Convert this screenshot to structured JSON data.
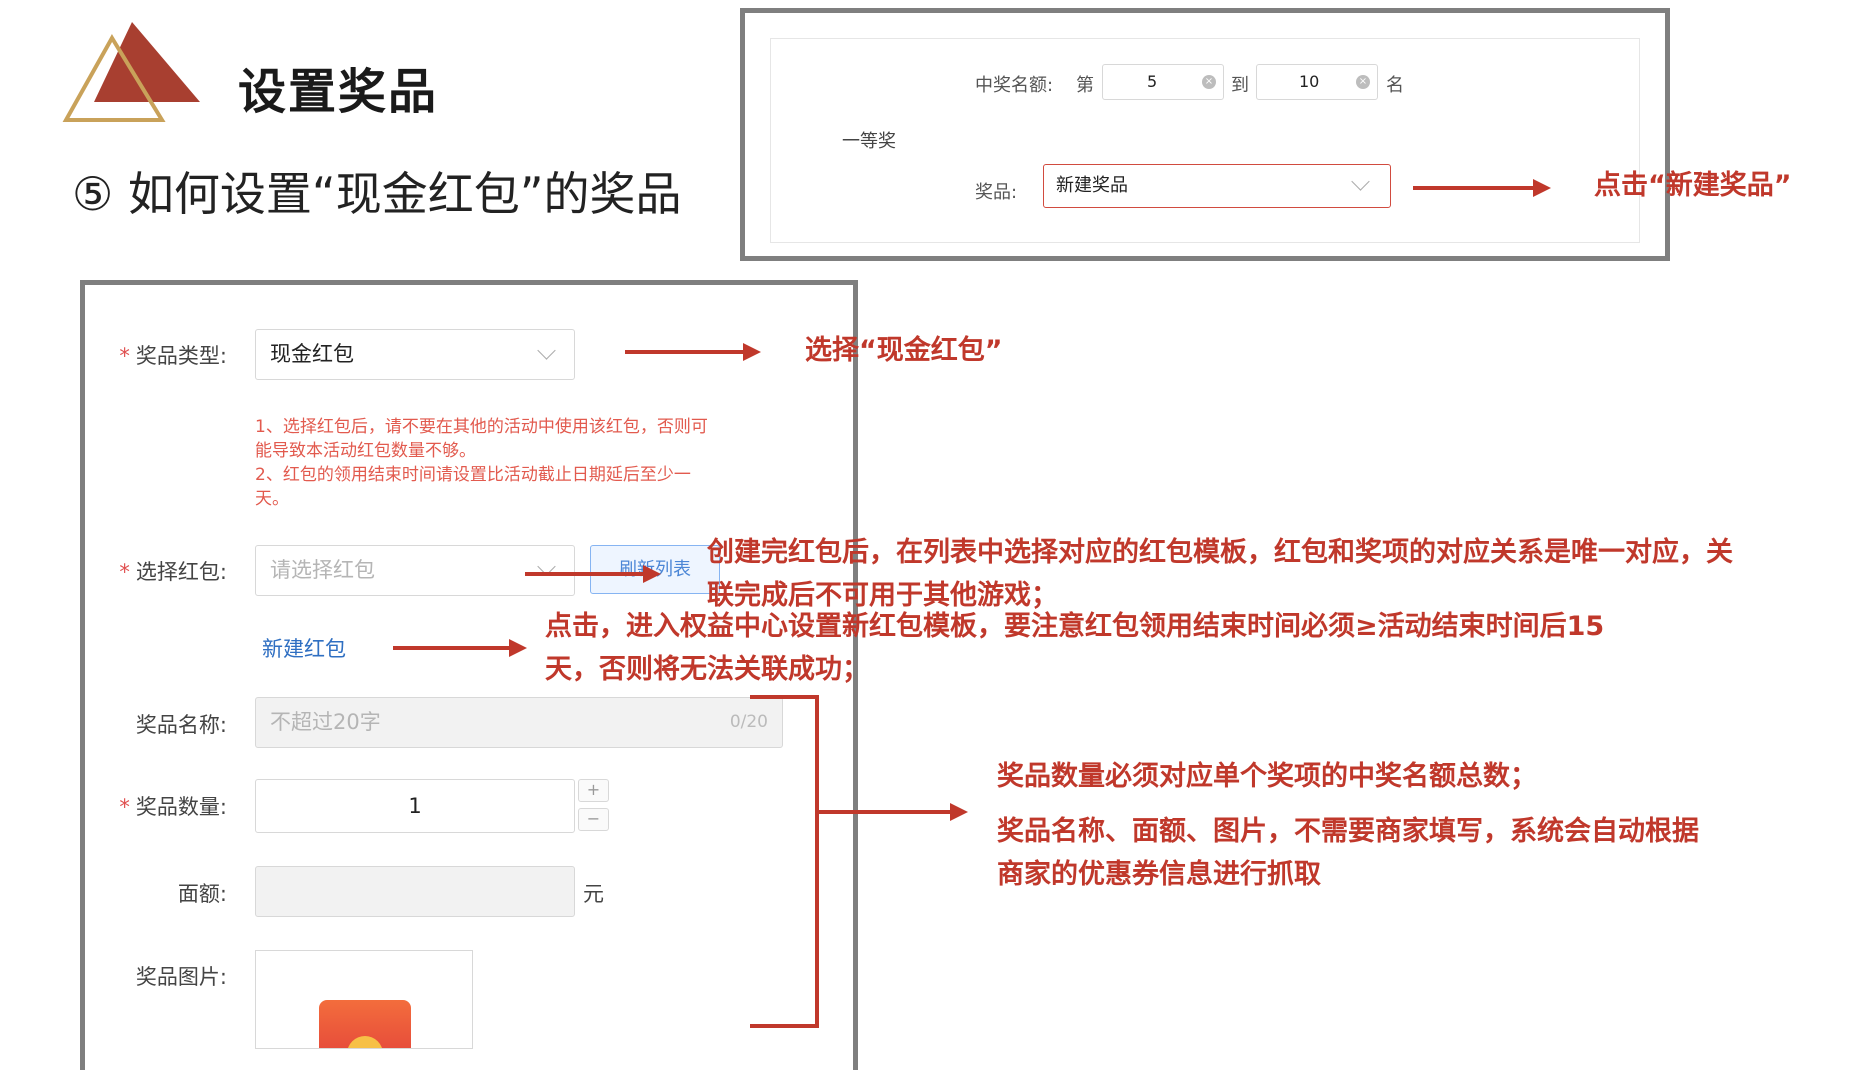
{
  "header": {
    "title": "设置奖品",
    "subtitle": "⑤ 如何设置“现金红包”的奖品"
  },
  "top_form": {
    "quota_label": "中奖名额:",
    "from_prefix": "第",
    "from_value": "5",
    "to_label": "到",
    "to_value": "10",
    "suffix": "名",
    "tier_label": "一等奖",
    "prize_label": "奖品:",
    "prize_select_value": "新建奖品",
    "annotation": "点击“新建奖品”"
  },
  "prize_form": {
    "type_label": "奖品类型:",
    "type_value": "现金红包",
    "type_annotation": "选择“现金红包”",
    "notes": [
      "1、选择红包后，请不要在其他的活动中使用该红包，否则可",
      "能导致本活动红包数量不够。",
      "2、红包的领用结束时间请设置比活动截止日期延后至少一",
      "天。"
    ],
    "redpack_label": "选择红包:",
    "redpack_placeholder": "请选择红包",
    "refresh_button": "刷新列表",
    "redpack_annotation_line1": "创建完红包后，在列表中选择对应的红包模板，红包和奖项的对应关系是唯一对应，关",
    "redpack_annotation_line2": "联完成后不可用于其他游戏；",
    "new_redpack_link": "新建红包",
    "new_redpack_annotation_line1": "点击，进入权益中心设置新红包模板，要注意红包领用结束时间必须≥活动结束时间后15",
    "new_redpack_annotation_line2": "天，否则将无法关联成功；",
    "name_label": "奖品名称:",
    "name_placeholder": "不超过20字",
    "name_counter": "0/20",
    "qty_label": "奖品数量:",
    "qty_value": "1",
    "qty_plus": "+",
    "qty_minus": "−",
    "amount_label": "面额:",
    "amount_unit": "元",
    "image_label": "奖品图片:",
    "bracket_annotation_line1": "奖品数量必须对应单个奖项的中奖名额总数；",
    "bracket_annotation_line2": "奖品名称、面额、图片，不需要商家填写，系统会自动根据",
    "bracket_annotation_line3": "商家的优惠券信息进行抓取"
  },
  "colors": {
    "accent_red": "#c0382b",
    "logo_gold": "#c9a25a",
    "border_gray": "#7f7f7f",
    "link_blue": "#2f6fc2"
  }
}
